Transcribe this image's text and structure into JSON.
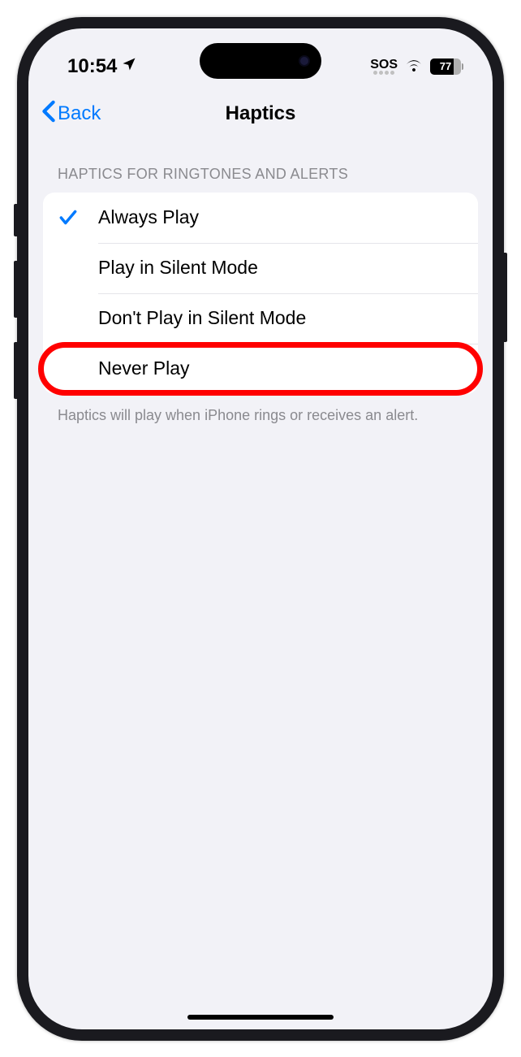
{
  "status": {
    "time": "10:54",
    "sos": "SOS",
    "battery": "77"
  },
  "nav": {
    "back_label": "Back",
    "title": "Haptics"
  },
  "section": {
    "header": "HAPTICS FOR RINGTONES AND ALERTS",
    "options": [
      {
        "label": "Always Play",
        "checked": true,
        "highlighted": false
      },
      {
        "label": "Play in Silent Mode",
        "checked": false,
        "highlighted": false
      },
      {
        "label": "Don't Play in Silent Mode",
        "checked": false,
        "highlighted": false
      },
      {
        "label": "Never Play",
        "checked": false,
        "highlighted": true
      }
    ],
    "footer": "Haptics will play when iPhone rings or receives an alert."
  }
}
